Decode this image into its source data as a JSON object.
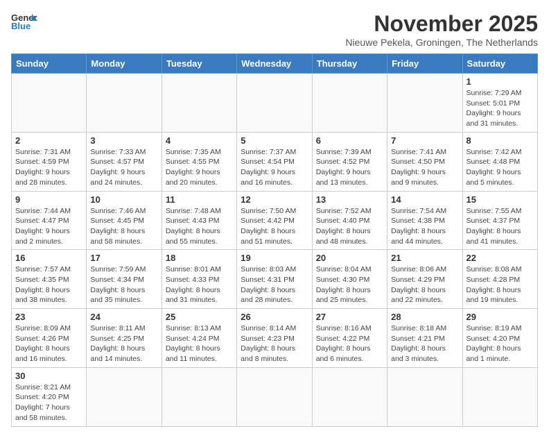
{
  "logo": {
    "text_general": "General",
    "text_blue": "Blue"
  },
  "header": {
    "month_year": "November 2025",
    "location": "Nieuwe Pekela, Groningen, The Netherlands"
  },
  "weekdays": [
    "Sunday",
    "Monday",
    "Tuesday",
    "Wednesday",
    "Thursday",
    "Friday",
    "Saturday"
  ],
  "weeks": [
    [
      {
        "day": "",
        "info": ""
      },
      {
        "day": "",
        "info": ""
      },
      {
        "day": "",
        "info": ""
      },
      {
        "day": "",
        "info": ""
      },
      {
        "day": "",
        "info": ""
      },
      {
        "day": "",
        "info": ""
      },
      {
        "day": "1",
        "info": "Sunrise: 7:29 AM\nSunset: 5:01 PM\nDaylight: 9 hours and 31 minutes."
      }
    ],
    [
      {
        "day": "2",
        "info": "Sunrise: 7:31 AM\nSunset: 4:59 PM\nDaylight: 9 hours and 28 minutes."
      },
      {
        "day": "3",
        "info": "Sunrise: 7:33 AM\nSunset: 4:57 PM\nDaylight: 9 hours and 24 minutes."
      },
      {
        "day": "4",
        "info": "Sunrise: 7:35 AM\nSunset: 4:55 PM\nDaylight: 9 hours and 20 minutes."
      },
      {
        "day": "5",
        "info": "Sunrise: 7:37 AM\nSunset: 4:54 PM\nDaylight: 9 hours and 16 minutes."
      },
      {
        "day": "6",
        "info": "Sunrise: 7:39 AM\nSunset: 4:52 PM\nDaylight: 9 hours and 13 minutes."
      },
      {
        "day": "7",
        "info": "Sunrise: 7:41 AM\nSunset: 4:50 PM\nDaylight: 9 hours and 9 minutes."
      },
      {
        "day": "8",
        "info": "Sunrise: 7:42 AM\nSunset: 4:48 PM\nDaylight: 9 hours and 5 minutes."
      }
    ],
    [
      {
        "day": "9",
        "info": "Sunrise: 7:44 AM\nSunset: 4:47 PM\nDaylight: 9 hours and 2 minutes."
      },
      {
        "day": "10",
        "info": "Sunrise: 7:46 AM\nSunset: 4:45 PM\nDaylight: 8 hours and 58 minutes."
      },
      {
        "day": "11",
        "info": "Sunrise: 7:48 AM\nSunset: 4:43 PM\nDaylight: 8 hours and 55 minutes."
      },
      {
        "day": "12",
        "info": "Sunrise: 7:50 AM\nSunset: 4:42 PM\nDaylight: 8 hours and 51 minutes."
      },
      {
        "day": "13",
        "info": "Sunrise: 7:52 AM\nSunset: 4:40 PM\nDaylight: 8 hours and 48 minutes."
      },
      {
        "day": "14",
        "info": "Sunrise: 7:54 AM\nSunset: 4:38 PM\nDaylight: 8 hours and 44 minutes."
      },
      {
        "day": "15",
        "info": "Sunrise: 7:55 AM\nSunset: 4:37 PM\nDaylight: 8 hours and 41 minutes."
      }
    ],
    [
      {
        "day": "16",
        "info": "Sunrise: 7:57 AM\nSunset: 4:35 PM\nDaylight: 8 hours and 38 minutes."
      },
      {
        "day": "17",
        "info": "Sunrise: 7:59 AM\nSunset: 4:34 PM\nDaylight: 8 hours and 35 minutes."
      },
      {
        "day": "18",
        "info": "Sunrise: 8:01 AM\nSunset: 4:33 PM\nDaylight: 8 hours and 31 minutes."
      },
      {
        "day": "19",
        "info": "Sunrise: 8:03 AM\nSunset: 4:31 PM\nDaylight: 8 hours and 28 minutes."
      },
      {
        "day": "20",
        "info": "Sunrise: 8:04 AM\nSunset: 4:30 PM\nDaylight: 8 hours and 25 minutes."
      },
      {
        "day": "21",
        "info": "Sunrise: 8:06 AM\nSunset: 4:29 PM\nDaylight: 8 hours and 22 minutes."
      },
      {
        "day": "22",
        "info": "Sunrise: 8:08 AM\nSunset: 4:28 PM\nDaylight: 8 hours and 19 minutes."
      }
    ],
    [
      {
        "day": "23",
        "info": "Sunrise: 8:09 AM\nSunset: 4:26 PM\nDaylight: 8 hours and 16 minutes."
      },
      {
        "day": "24",
        "info": "Sunrise: 8:11 AM\nSunset: 4:25 PM\nDaylight: 8 hours and 14 minutes."
      },
      {
        "day": "25",
        "info": "Sunrise: 8:13 AM\nSunset: 4:24 PM\nDaylight: 8 hours and 11 minutes."
      },
      {
        "day": "26",
        "info": "Sunrise: 8:14 AM\nSunset: 4:23 PM\nDaylight: 8 hours and 8 minutes."
      },
      {
        "day": "27",
        "info": "Sunrise: 8:16 AM\nSunset: 4:22 PM\nDaylight: 8 hours and 6 minutes."
      },
      {
        "day": "28",
        "info": "Sunrise: 8:18 AM\nSunset: 4:21 PM\nDaylight: 8 hours and 3 minutes."
      },
      {
        "day": "29",
        "info": "Sunrise: 8:19 AM\nSunset: 4:20 PM\nDaylight: 8 hours and 1 minute."
      }
    ],
    [
      {
        "day": "30",
        "info": "Sunrise: 8:21 AM\nSunset: 4:20 PM\nDaylight: 7 hours and 58 minutes."
      },
      {
        "day": "",
        "info": ""
      },
      {
        "day": "",
        "info": ""
      },
      {
        "day": "",
        "info": ""
      },
      {
        "day": "",
        "info": ""
      },
      {
        "day": "",
        "info": ""
      },
      {
        "day": "",
        "info": ""
      }
    ]
  ]
}
